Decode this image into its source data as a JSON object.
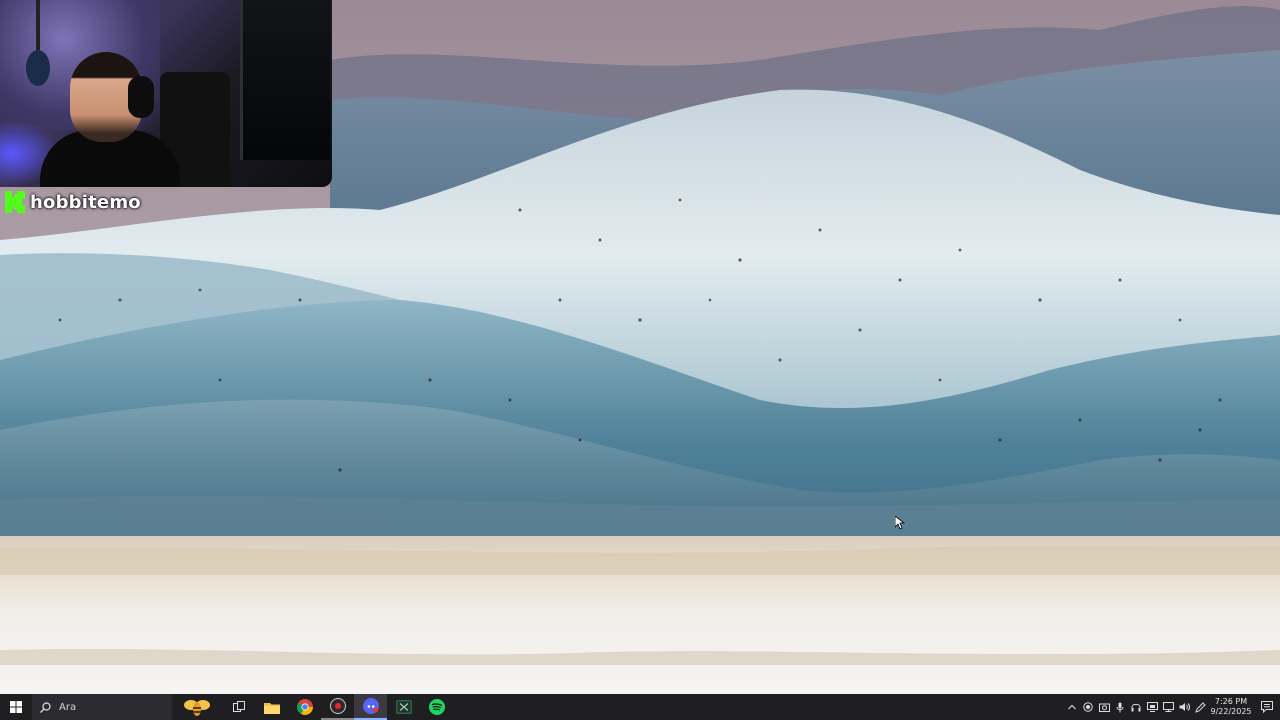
{
  "stream_overlay": {
    "streamer_name": "hobbitemo",
    "platform_icon": "kick-logo-icon",
    "brand_color": "#53fc18"
  },
  "taskbar": {
    "start_icon": "windows-start-icon",
    "search": {
      "placeholder": "Ara",
      "icon": "search-icon"
    },
    "pinned_apps": [
      {
        "name": "search-widget-bee",
        "icon": "bee-widget-icon"
      },
      {
        "name": "task-view",
        "icon": "task-view-icon"
      },
      {
        "name": "file-explorer",
        "icon": "folder-icon"
      },
      {
        "name": "chrome",
        "icon": "chrome-icon"
      },
      {
        "name": "obs-studio",
        "icon": "obs-record-icon"
      },
      {
        "name": "discord",
        "icon": "discord-icon"
      },
      {
        "name": "excel",
        "icon": "excel-icon"
      },
      {
        "name": "spotify",
        "icon": "spotify-icon"
      }
    ],
    "tray": {
      "icons": [
        "chevron-up-icon",
        "record-icon",
        "camera-icon",
        "microphone-icon",
        "headphones-icon",
        "display-icon",
        "network-icon",
        "volume-icon",
        "pen-icon"
      ],
      "time": "7:26 PM",
      "date": "9/22/2025",
      "notification_icon": "notification-icon"
    }
  }
}
